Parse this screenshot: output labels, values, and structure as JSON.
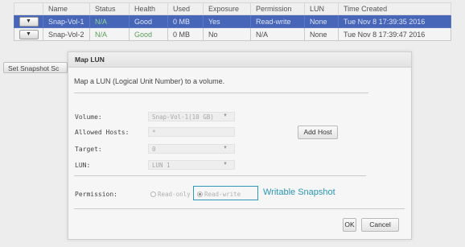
{
  "table": {
    "headers": [
      "",
      "Name",
      "Status",
      "Health",
      "Used",
      "Exposure",
      "Permission",
      "LUN",
      "Time Created"
    ],
    "rows": [
      {
        "arrow": "▼",
        "name": "Snap-Vol-1",
        "status": "N/A",
        "health": "Good",
        "used": "0 MB",
        "exposure": "Yes",
        "permission": "Read-write",
        "lun": "None",
        "time": "Tue Nov 8 17:39:35 2016",
        "selected": true
      },
      {
        "arrow": "▼",
        "name": "Snap-Vol-2",
        "status": "N/A",
        "health": "Good",
        "used": "0 MB",
        "exposure": "No",
        "permission": "N/A",
        "lun": "None",
        "time": "Tue Nov 8 17:39:47 2016",
        "selected": false
      }
    ]
  },
  "snapshot_button": "Set Snapshot Sc",
  "dialog": {
    "title": "Map LUN",
    "description": "Map a LUN (Logical Unit Number) to a volume.",
    "volume_label": "Volume:",
    "volume_value": "Snap-Vol-1(10 GB)",
    "hosts_label": "Allowed Hosts:",
    "hosts_value": "*",
    "add_host_button": "Add Host",
    "target_label": "Target:",
    "target_value": "0",
    "lun_label": "LUN:",
    "lun_value": "LUN 1",
    "permission_label": "Permission:",
    "read_only_label": "Read-only",
    "read_write_label": "Read-write",
    "ok_button": "OK",
    "cancel_button": "Cancel"
  },
  "annotation": "Writable Snapshot",
  "colors": {
    "selected_row": "#4766b7",
    "annotation": "#2a96b4"
  },
  "icons": {
    "row_expand": "chevron-down-icon",
    "select_caret": "caret-down-icon"
  }
}
